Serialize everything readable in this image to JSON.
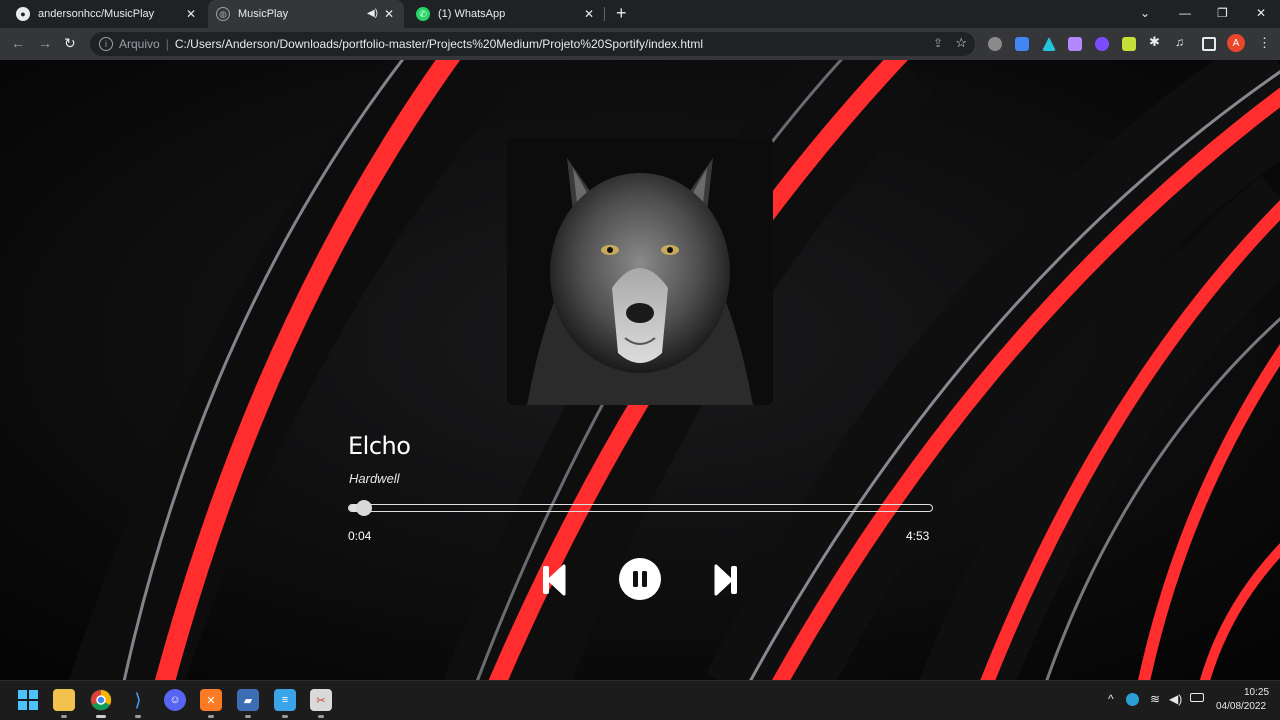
{
  "browser": {
    "tabs": [
      {
        "title": "andersonhcc/MusicPlay",
        "active": false
      },
      {
        "title": "MusicPlay",
        "active": true,
        "audio": true
      },
      {
        "title": "(1) WhatsApp",
        "active": false
      }
    ],
    "new_tab": "+",
    "address": {
      "scheme_label": "Arquivo",
      "url": "C:/Users/Anderson/Downloads/portfolio-master/Projects%20Medium/Projeto%20Sportify/index.html"
    },
    "profile_initial": "A"
  },
  "player": {
    "song_title": "Elcho",
    "artist": "Hardwell",
    "current_time": "0:04",
    "total_time": "4:53",
    "progress": 0.025,
    "controls": {
      "previous": "skip-previous-icon",
      "play_pause": "pause-icon",
      "next": "skip-next-icon"
    },
    "cover": "wolf-portrait-image"
  },
  "colors": {
    "accent_red": "#ff2d2d",
    "background": "#050505"
  },
  "taskbar": {
    "apps": [
      "start-icon",
      "file-explorer-icon",
      "chrome-icon",
      "vscode-icon",
      "discord-icon",
      "xampp-icon",
      "sublime-icon",
      "notepad-icon",
      "snipping-tool-icon"
    ],
    "clock_time": "10:25",
    "clock_date": "04/08/2022"
  }
}
